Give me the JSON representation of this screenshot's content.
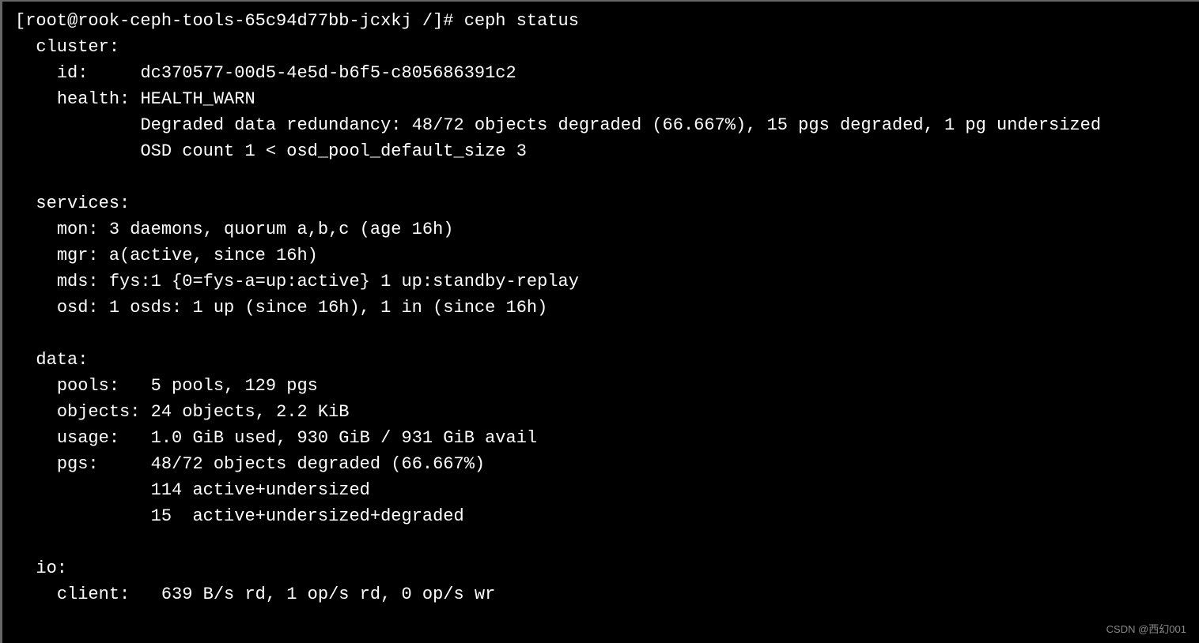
{
  "prompt": {
    "user": "root",
    "host": "rook-ceph-tools-65c94d77bb-jcxkj",
    "path": "/",
    "symbol": "#",
    "command": "ceph status"
  },
  "cluster": {
    "header": "cluster:",
    "id_label": "id:",
    "id_value": "dc370577-00d5-4e5d-b6f5-c805686391c2",
    "health_label": "health:",
    "health_value": "HEALTH_WARN",
    "health_detail1": "Degraded data redundancy: 48/72 objects degraded (66.667%), 15 pgs degraded, 1 pg undersized",
    "health_detail2": "OSD count 1 < osd_pool_default_size 3"
  },
  "services": {
    "header": "services:",
    "mon": "mon: 3 daemons, quorum a,b,c (age 16h)",
    "mgr": "mgr: a(active, since 16h)",
    "mds": "mds: fys:1 {0=fys-a=up:active} 1 up:standby-replay",
    "osd": "osd: 1 osds: 1 up (since 16h), 1 in (since 16h)"
  },
  "data": {
    "header": "data:",
    "pools_label": "pools:",
    "pools_value": "5 pools, 129 pgs",
    "objects_label": "objects:",
    "objects_value": "24 objects, 2.2 KiB",
    "usage_label": "usage:",
    "usage_value": "1.0 GiB used, 930 GiB / 931 GiB avail",
    "pgs_label": "pgs:",
    "pgs_value": "48/72 objects degraded (66.667%)",
    "pgs_detail1": "114 active+undersized",
    "pgs_detail2": "15  active+undersized+degraded"
  },
  "io": {
    "header": "io:",
    "client_label": "client:",
    "client_value": "639 B/s rd, 1 op/s rd, 0 op/s wr"
  },
  "watermark": "CSDN @西幻001"
}
